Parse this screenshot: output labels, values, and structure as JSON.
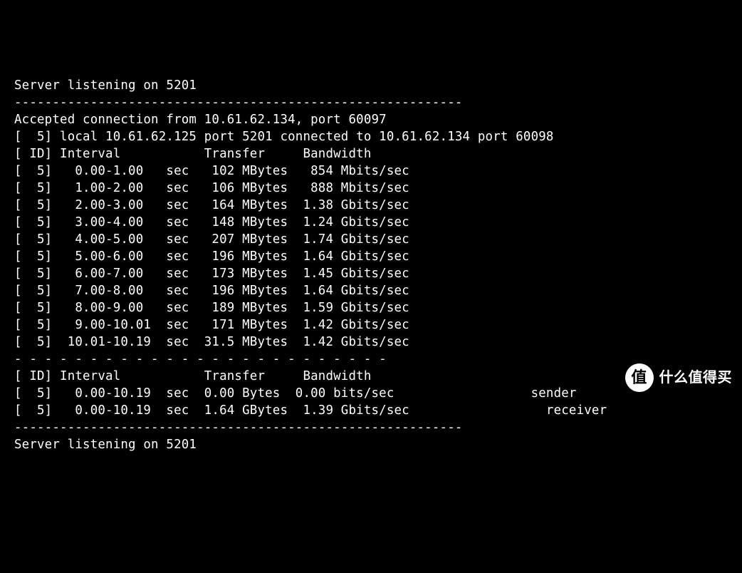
{
  "terminal": {
    "listening1": "Server listening on 5201",
    "divider_solid": "-----------------------------------------------------------",
    "accepted": "Accepted connection from 10.61.62.134, port 60097",
    "local": "[  5] local 10.61.62.125 port 5201 connected to 10.61.62.134 port 60098",
    "header": "[ ID] Interval           Transfer     Bandwidth",
    "rows": [
      "[  5]   0.00-1.00   sec   102 MBytes   854 Mbits/sec",
      "[  5]   1.00-2.00   sec   106 MBytes   888 Mbits/sec",
      "[  5]   2.00-3.00   sec   164 MBytes  1.38 Gbits/sec",
      "[  5]   3.00-4.00   sec   148 MBytes  1.24 Gbits/sec",
      "[  5]   4.00-5.00   sec   207 MBytes  1.74 Gbits/sec",
      "[  5]   5.00-6.00   sec   196 MBytes  1.64 Gbits/sec",
      "[  5]   6.00-7.00   sec   173 MBytes  1.45 Gbits/sec",
      "[  5]   7.00-8.00   sec   196 MBytes  1.64 Gbits/sec",
      "[  5]   8.00-9.00   sec   189 MBytes  1.59 Gbits/sec",
      "[  5]   9.00-10.01  sec   171 MBytes  1.42 Gbits/sec",
      "[  5]  10.01-10.19  sec  31.5 MBytes  1.42 Gbits/sec"
    ],
    "divider_dashed": "- - - - - - - - - - - - - - - - - - - - - - - - -",
    "summary_header": "[ ID] Interval           Transfer     Bandwidth",
    "summary": [
      "[  5]   0.00-10.19  sec  0.00 Bytes  0.00 bits/sec                  sender",
      "[  5]   0.00-10.19  sec  1.64 GBytes  1.39 Gbits/sec                  receiver"
    ],
    "listening2": "Server listening on 5201"
  },
  "watermark": {
    "badge": "值",
    "brand": "什么值得买"
  },
  "chart_data": {
    "type": "table",
    "title": "iperf3 server bandwidth report",
    "columns": [
      "ID",
      "Interval (sec)",
      "Transfer",
      "Bandwidth"
    ],
    "rows": [
      [
        5,
        "0.00-1.00",
        "102 MBytes",
        "854 Mbits/sec"
      ],
      [
        5,
        "1.00-2.00",
        "106 MBytes",
        "888 Mbits/sec"
      ],
      [
        5,
        "2.00-3.00",
        "164 MBytes",
        "1.38 Gbits/sec"
      ],
      [
        5,
        "3.00-4.00",
        "148 MBytes",
        "1.24 Gbits/sec"
      ],
      [
        5,
        "4.00-5.00",
        "207 MBytes",
        "1.74 Gbits/sec"
      ],
      [
        5,
        "5.00-6.00",
        "196 MBytes",
        "1.64 Gbits/sec"
      ],
      [
        5,
        "6.00-7.00",
        "173 MBytes",
        "1.45 Gbits/sec"
      ],
      [
        5,
        "7.00-8.00",
        "196 MBytes",
        "1.64 Gbits/sec"
      ],
      [
        5,
        "8.00-9.00",
        "189 MBytes",
        "1.59 Gbits/sec"
      ],
      [
        5,
        "9.00-10.01",
        "171 MBytes",
        "1.42 Gbits/sec"
      ],
      [
        5,
        "10.01-10.19",
        "31.5 MBytes",
        "1.42 Gbits/sec"
      ]
    ],
    "summary": [
      {
        "id": 5,
        "interval": "0.00-10.19",
        "transfer": "0.00 Bytes",
        "bandwidth": "0.00 bits/sec",
        "role": "sender"
      },
      {
        "id": 5,
        "interval": "0.00-10.19",
        "transfer": "1.64 GBytes",
        "bandwidth": "1.39 Gbits/sec",
        "role": "receiver"
      }
    ],
    "server_port": 5201,
    "client_ip": "10.61.62.134",
    "client_control_port": 60097,
    "client_data_port": 60098,
    "server_ip": "10.61.62.125"
  }
}
